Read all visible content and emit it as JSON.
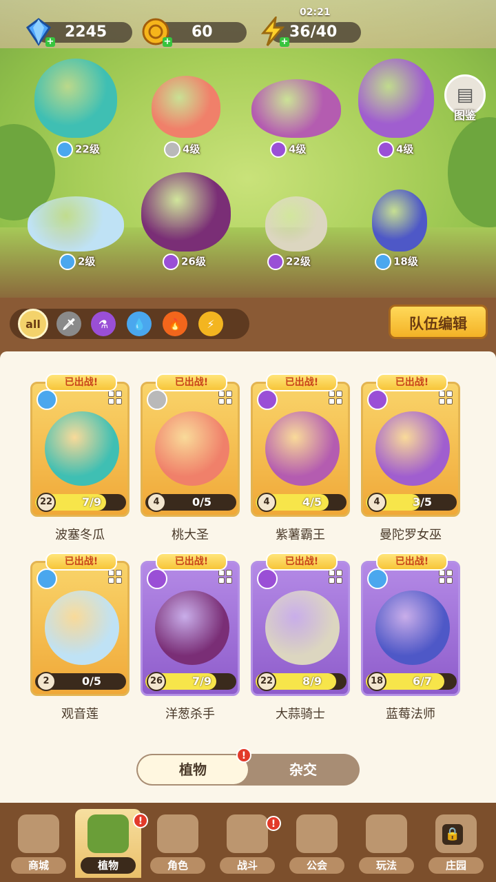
{
  "resources": {
    "gems": "2245",
    "coins": "60",
    "energy": "36/40",
    "energy_timer": "02:21"
  },
  "atlas_label": "图鉴",
  "garden": [
    {
      "level": "22级",
      "element": "water"
    },
    {
      "level": "4级",
      "element": "sword"
    },
    {
      "level": "4级",
      "element": "potion"
    },
    {
      "level": "4级",
      "element": "potion"
    },
    {
      "level": "2级",
      "element": "water"
    },
    {
      "level": "26级",
      "element": "potion"
    },
    {
      "level": "22级",
      "element": "potion"
    },
    {
      "level": "18级",
      "element": "water"
    }
  ],
  "filters": {
    "all_label": "all",
    "icons": [
      "sword-icon",
      "potion-icon",
      "water-icon",
      "fire-icon",
      "lightning-icon"
    ]
  },
  "team_edit_label": "队伍编辑",
  "deployed_label": "已出战!",
  "cards": [
    {
      "name": "波塞冬瓜",
      "level": "22",
      "progress": "7/9",
      "ratio": 0.78,
      "rarity": "gold",
      "element": "water"
    },
    {
      "name": "桃大圣",
      "level": "4",
      "progress": "0/5",
      "ratio": 0.0,
      "rarity": "gold",
      "element": "sword"
    },
    {
      "name": "紫薯霸王",
      "level": "4",
      "progress": "4/5",
      "ratio": 0.8,
      "rarity": "gold",
      "element": "potion"
    },
    {
      "name": "曼陀罗女巫",
      "level": "4",
      "progress": "3/5",
      "ratio": 0.6,
      "rarity": "gold",
      "element": "potion"
    },
    {
      "name": "观音莲",
      "level": "2",
      "progress": "0/5",
      "ratio": 0.0,
      "rarity": "gold",
      "element": "water"
    },
    {
      "name": "洋葱杀手",
      "level": "26",
      "progress": "7/9",
      "ratio": 0.78,
      "rarity": "purple",
      "element": "potion"
    },
    {
      "name": "大蒜骑士",
      "level": "22",
      "progress": "8/9",
      "ratio": 0.89,
      "rarity": "purple",
      "element": "potion"
    },
    {
      "name": "蓝莓法师",
      "level": "18",
      "progress": "6/7",
      "ratio": 0.86,
      "rarity": "purple",
      "element": "water"
    }
  ],
  "toggle": {
    "active": "植物",
    "inactive": "杂交",
    "alert": "!"
  },
  "nav": [
    {
      "label": "商城"
    },
    {
      "label": "植物"
    },
    {
      "label": "角色"
    },
    {
      "label": "战斗"
    },
    {
      "label": "公会"
    },
    {
      "label": "玩法"
    },
    {
      "label": "庄园"
    }
  ],
  "colors": {
    "water": "#4aa7ee",
    "sword": "#b9b9b9",
    "potion": "#9a4fd6",
    "fire": "#f2661c",
    "lightning": "#f3b520"
  }
}
